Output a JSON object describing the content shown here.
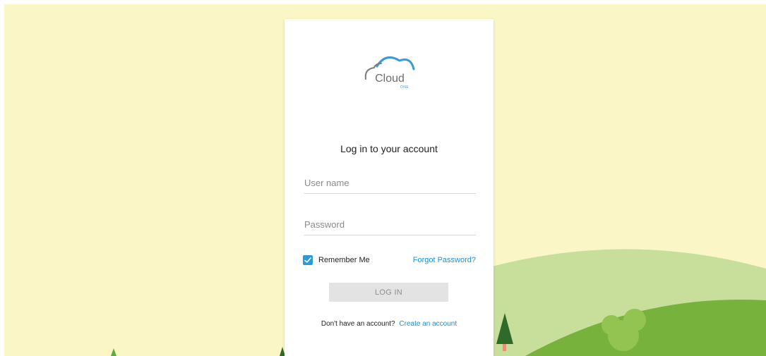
{
  "logo": {
    "text_main": "Cloud",
    "text_sub": "ONE"
  },
  "login": {
    "title": "Log in to your account",
    "username_placeholder": "User name",
    "username_value": "",
    "password_placeholder": "Password",
    "password_value": "",
    "remember_label": "Remember Me",
    "remember_checked": true,
    "forgot_label": "Forgot Password?",
    "submit_label": "LOG IN",
    "signup_prompt": "Don't have an account?",
    "signup_link": "Create an account"
  },
  "colors": {
    "background": "#faf6c6",
    "accent": "#1e8fd0",
    "hill_light": "#c7df9b",
    "hill_dark": "#77b33c",
    "button_disabled": "#e3e3e3"
  }
}
